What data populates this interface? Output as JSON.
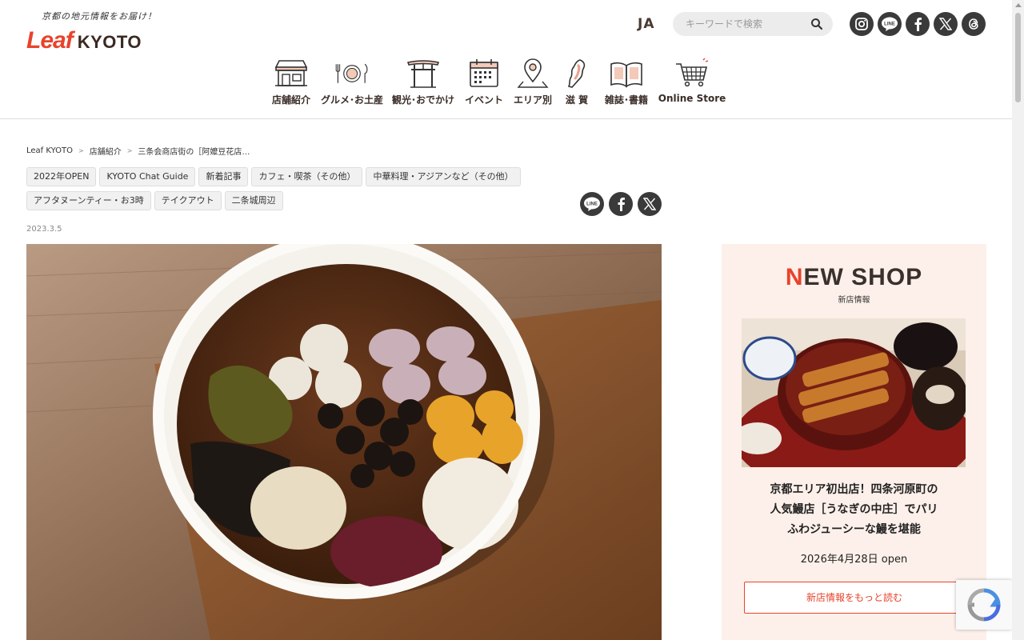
{
  "header": {
    "tagline": "京都の地元情報をお届け！",
    "logo_leaf": "Leaf",
    "logo_kyoto": "KYOTO",
    "lang": "JA",
    "search_placeholder": "キーワードで検索"
  },
  "nav": [
    {
      "label": "店舗紹介",
      "icon": "storefront-icon"
    },
    {
      "label": "グルメ･お土産",
      "icon": "dining-icon"
    },
    {
      "label": "観光･おでかけ",
      "icon": "torii-gate-icon"
    },
    {
      "label": "イベント",
      "icon": "calendar-icon"
    },
    {
      "label": "エリア別",
      "icon": "map-pin-icon"
    },
    {
      "label": "滋 賀",
      "icon": "shiga-map-icon"
    },
    {
      "label": "雑誌･書籍",
      "icon": "book-icon"
    },
    {
      "label": "Online Store",
      "icon": "cart-icon"
    }
  ],
  "breadcrumb": [
    "Leaf KYOTO",
    "店舗紹介",
    "三条会商店街の［阿嬤豆花店…"
  ],
  "tags": [
    "2022年OPEN",
    "KYOTO Chat Guide",
    "新着記事",
    "カフェ・喫茶（その他）",
    "中華料理・アジアンなど（その他）",
    "アフタヌーンティー・お3時",
    "テイクアウト",
    "二条城周辺"
  ],
  "date": "2023.3.5",
  "sidebar": {
    "title_n": "N",
    "title_rest": "EW SHOP",
    "subtitle": "新店情報",
    "headline_line1": "京都エリア初出店！四条河原町の",
    "headline_line2": "人気鰻店［うなぎの中庄］でパリ",
    "headline_line3": "ふわジューシーな鰻を堪能",
    "date": "2026年4月28日 open",
    "more_label": "新店情報をもっと読む"
  },
  "colors": {
    "accent": "#e8432b",
    "dark": "#3a3a3a",
    "sidebar_bg": "#fdf0ea"
  }
}
